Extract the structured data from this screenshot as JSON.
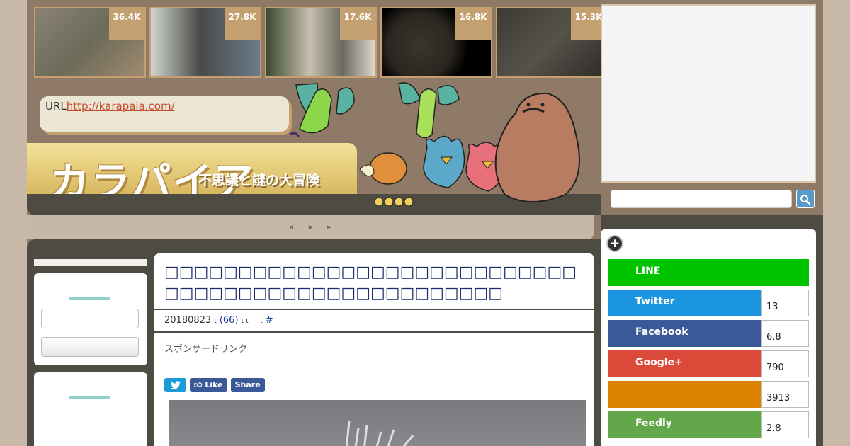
{
  "thumbnails": [
    {
      "count": "36.4K"
    },
    {
      "count": "27.8K"
    },
    {
      "count": "17.6K"
    },
    {
      "count": "16.8K"
    },
    {
      "count": "15.3K"
    }
  ],
  "header": {
    "url_prefix": "URL",
    "url_link": "http://karapaia.com/",
    "logo": "カラパイア",
    "tagline": "不思議と謎の大冒険"
  },
  "nav": {
    "items": [
      "»",
      "»",
      "»"
    ]
  },
  "article": {
    "title": "□□□□□□□□□□□□□□□□□□□□□□□□□□□□□□□□□□□□□□□□□□□□□□□□□□□",
    "date": "20180823",
    "sep1": "ι",
    "comments": "(66)",
    "sep2": "ι ι",
    "sep3": "ι",
    "hash": "#",
    "sponsor": "スポンサードリンク",
    "share_buttons": [
      {
        "label": "",
        "color": "#1d9bd7"
      },
      {
        "label": "Like",
        "color": "#3b5998"
      },
      {
        "label": "Share",
        "color": "#3b5998"
      }
    ]
  },
  "social": [
    {
      "label": "LINE",
      "count": "",
      "color": "#00c300"
    },
    {
      "label": "Twitter",
      "count": "13",
      "color": "#1b95e0"
    },
    {
      "label": "Facebook",
      "count": "6.8",
      "color": "#3b5998"
    },
    {
      "label": "Google+",
      "count": "790",
      "color": "#db4a39"
    },
    {
      "label": "",
      "count": "3913",
      "color": "#db8400"
    },
    {
      "label": "Feedly",
      "count": "2.8",
      "color": "#6cc655"
    }
  ],
  "colors": {
    "accent": "#c4a070",
    "dark": "#4e4b42",
    "brown": "#8e7a66"
  }
}
